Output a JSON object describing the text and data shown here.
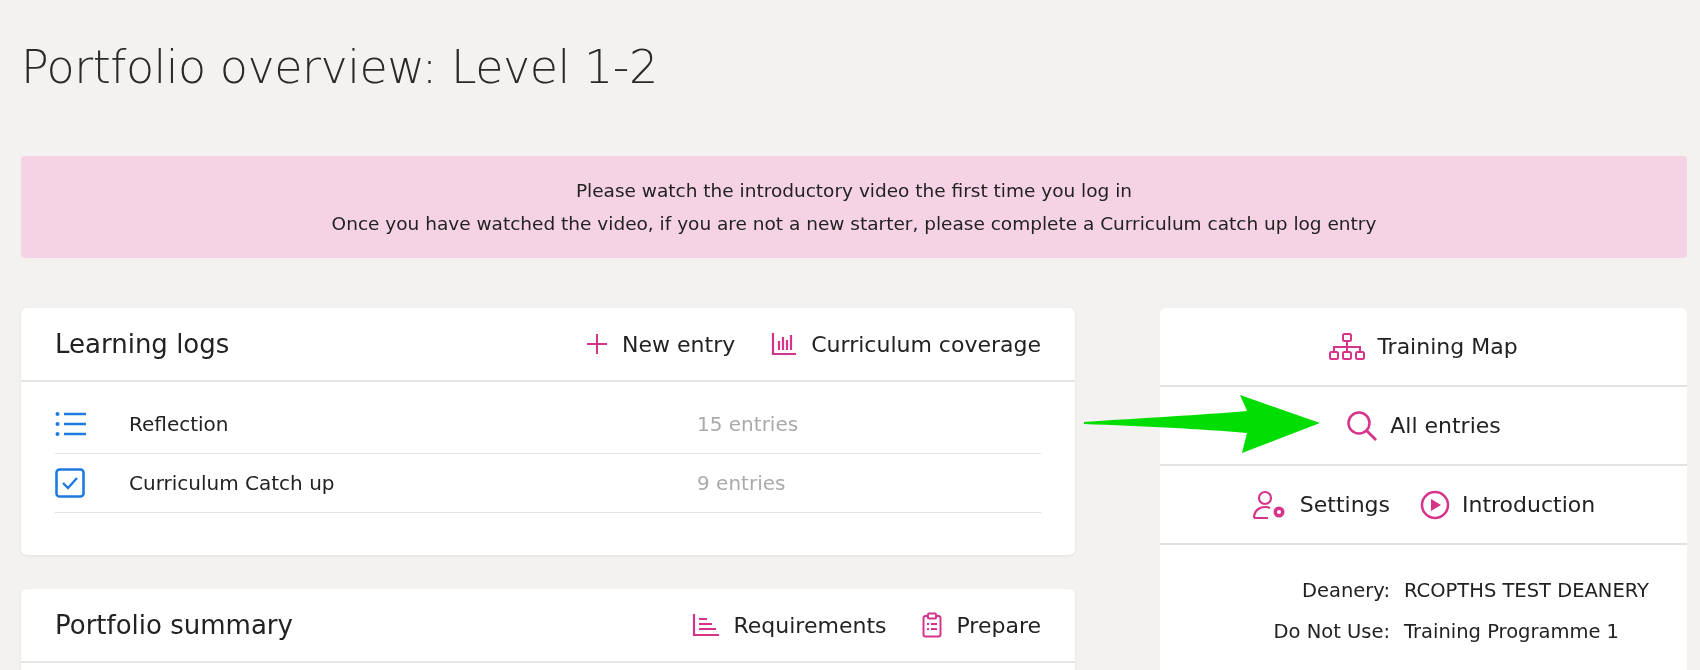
{
  "page_title": "Portfolio overview: Level 1-2",
  "notice": [
    "Please watch the introductory video the first time you log in",
    "Once you have watched the video, if you are not a new starter, please complete a Curriculum catch up log entry"
  ],
  "learning_logs": {
    "title": "Learning logs",
    "actions": [
      {
        "kind": "plus",
        "label": "New entry"
      },
      {
        "kind": "chart",
        "label": "Curriculum coverage"
      }
    ],
    "rows": [
      {
        "kind": "list",
        "name": "Reflection",
        "count": "15 entries"
      },
      {
        "kind": "checkbox",
        "name": "Curriculum Catch up",
        "count": "9 entries"
      }
    ]
  },
  "portfolio_summary": {
    "title": "Portfolio summary",
    "actions": [
      {
        "kind": "bars",
        "label": "Requirements"
      },
      {
        "kind": "clipboard",
        "label": "Prepare"
      }
    ]
  },
  "side_panel": {
    "links": [
      [
        {
          "kind": "hierarchy",
          "label": "Training Map"
        }
      ],
      [
        {
          "kind": "search",
          "label": "All entries"
        }
      ],
      [
        {
          "kind": "user-settings",
          "label": "Settings"
        },
        {
          "kind": "play",
          "label": "Introduction"
        }
      ]
    ],
    "details": [
      {
        "label": "Deanery:",
        "value": "RCOPTHS TEST DEANERY"
      },
      {
        "label": "Do Not Use:",
        "value": "Training Programme 1"
      }
    ]
  }
}
